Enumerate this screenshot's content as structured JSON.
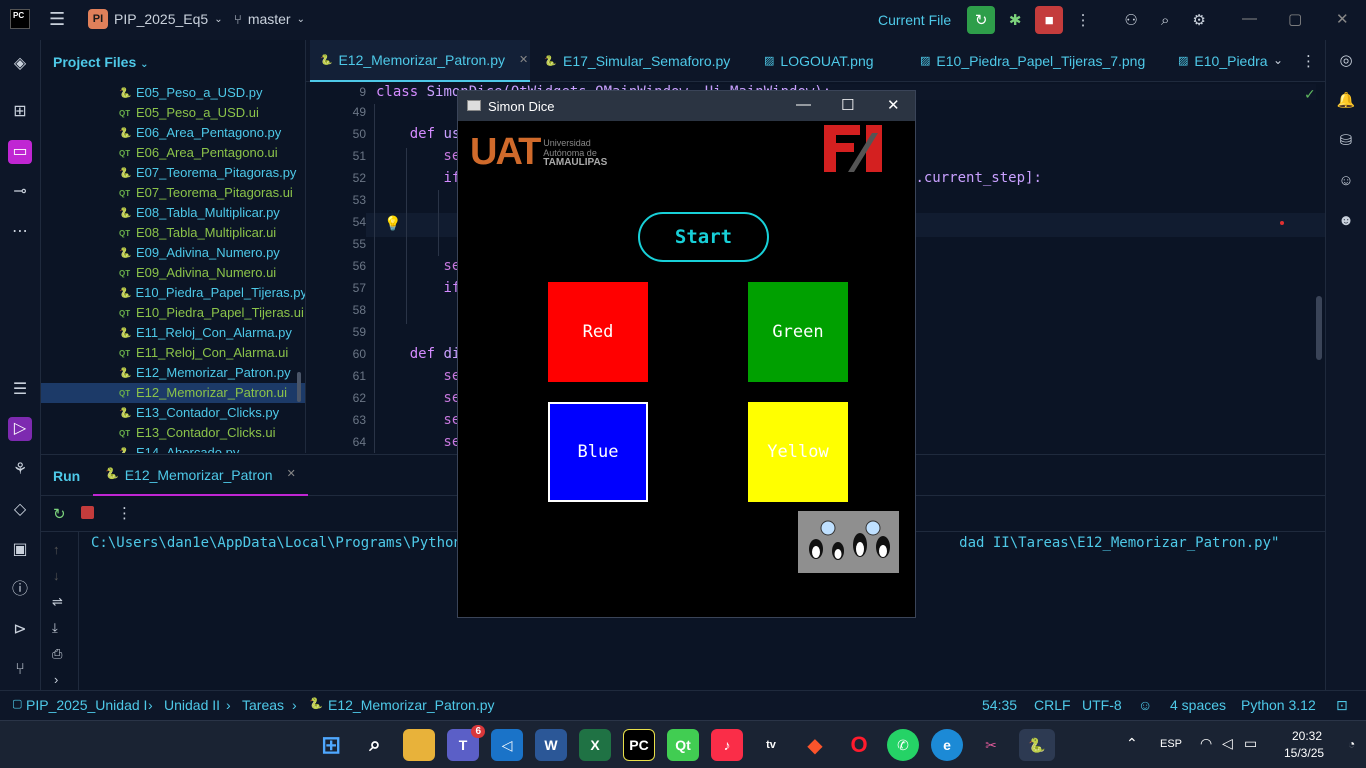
{
  "titlebar": {
    "logo_text": "PC",
    "project_badge": "PI",
    "project_name": "PIP_2025_Eq5",
    "branch": "master",
    "current_file": "Current File"
  },
  "project_panel": {
    "title": "Project Files",
    "items": [
      {
        "name": "E05_Peso_a_USD.py",
        "kind": "py"
      },
      {
        "name": "E05_Peso_a_USD.ui",
        "kind": "ui"
      },
      {
        "name": "E06_Area_Pentagono.py",
        "kind": "py"
      },
      {
        "name": "E06_Area_Pentagono.ui",
        "kind": "ui"
      },
      {
        "name": "E07_Teorema_Pitagoras.py",
        "kind": "py"
      },
      {
        "name": "E07_Teorema_Pitagoras.ui",
        "kind": "ui"
      },
      {
        "name": "E08_Tabla_Multiplicar.py",
        "kind": "py"
      },
      {
        "name": "E08_Tabla_Multiplicar.ui",
        "kind": "ui"
      },
      {
        "name": "E09_Adivina_Numero.py",
        "kind": "py"
      },
      {
        "name": "E09_Adivina_Numero.ui",
        "kind": "ui"
      },
      {
        "name": "E10_Piedra_Papel_Tijeras.py",
        "kind": "py"
      },
      {
        "name": "E10_Piedra_Papel_Tijeras.ui",
        "kind": "ui"
      },
      {
        "name": "E11_Reloj_Con_Alarma.py",
        "kind": "py"
      },
      {
        "name": "E11_Reloj_Con_Alarma.ui",
        "kind": "ui"
      },
      {
        "name": "E12_Memorizar_Patron.py",
        "kind": "py"
      },
      {
        "name": "E12_Memorizar_Patron.ui",
        "kind": "ui",
        "selected": true
      },
      {
        "name": "E13_Contador_Clicks.py",
        "kind": "py"
      },
      {
        "name": "E13_Contador_Clicks.ui",
        "kind": "ui"
      },
      {
        "name": "E14_Ahorcado.py",
        "kind": "py"
      }
    ]
  },
  "tabs": [
    {
      "label": "E12_Memorizar_Patron.py",
      "active": true
    },
    {
      "label": "E17_Simular_Semaforo.py"
    },
    {
      "label": "LOGOUAT.png"
    },
    {
      "label": "E10_Piedra_Papel_Tijeras_7.png"
    },
    {
      "label": "E10_Piedra"
    }
  ],
  "editor": {
    "lines": [
      {
        "n": "9",
        "text": "class SimonDice(QtWidgets.QMainWindow, Ui_MainWindow):",
        "kw": "class"
      },
      {
        "n": "49",
        "text": ""
      },
      {
        "n": "50",
        "text": "    def us",
        "kw": "def"
      },
      {
        "n": "51",
        "text": "        se"
      },
      {
        "n": "52",
        "text": "        if                                                     f.current_step]:"
      },
      {
        "n": "53",
        "text": ""
      },
      {
        "n": "54",
        "text": ""
      },
      {
        "n": "55",
        "text": ""
      },
      {
        "n": "56",
        "text": "        se"
      },
      {
        "n": "57",
        "text": "        if"
      },
      {
        "n": "58",
        "text": ""
      },
      {
        "n": "59",
        "text": ""
      },
      {
        "n": "60",
        "text": "    def di",
        "kw": "def"
      },
      {
        "n": "61",
        "text": "        se"
      },
      {
        "n": "62",
        "text": "        se"
      },
      {
        "n": "63",
        "text": "        se"
      },
      {
        "n": "64",
        "text": "        se"
      }
    ]
  },
  "run": {
    "label": "Run",
    "tab": "E12_Memorizar_Patron",
    "console_line": "C:\\Users\\dan1e\\AppData\\Local\\Programs\\Python\\P                                                         dad II\\Tareas\\E12_Memorizar_Patron.py\""
  },
  "statusbar": {
    "breadcrumbs": [
      "PIP_2025_Unidad I",
      "Unidad II",
      "Tareas",
      "E12_Memorizar_Patron.py"
    ],
    "position": "54:35",
    "line_sep": "CRLF",
    "encoding": "UTF-8",
    "indent": "4 spaces",
    "interpreter": "Python 3.12"
  },
  "taskbar": {
    "teams_badge": "6",
    "lang": "ESP",
    "time": "20:32",
    "date": "15/3/25"
  },
  "simon": {
    "title": "Simon Dice",
    "uat_big": "UAT",
    "uat_small_1": "Universidad",
    "uat_small_2": "Autónoma de",
    "uat_small_3": "TAMAULIPAS",
    "start": "Start",
    "red": "Red",
    "green": "Green",
    "blue": "Blue",
    "yellow": "Yellow"
  },
  "colors": {
    "accent": "#4ec9e8",
    "red": "#ff0000",
    "green": "#00a000",
    "blue": "#0000ff",
    "yellow": "#ffff00",
    "start_border": "#18d0d8"
  }
}
